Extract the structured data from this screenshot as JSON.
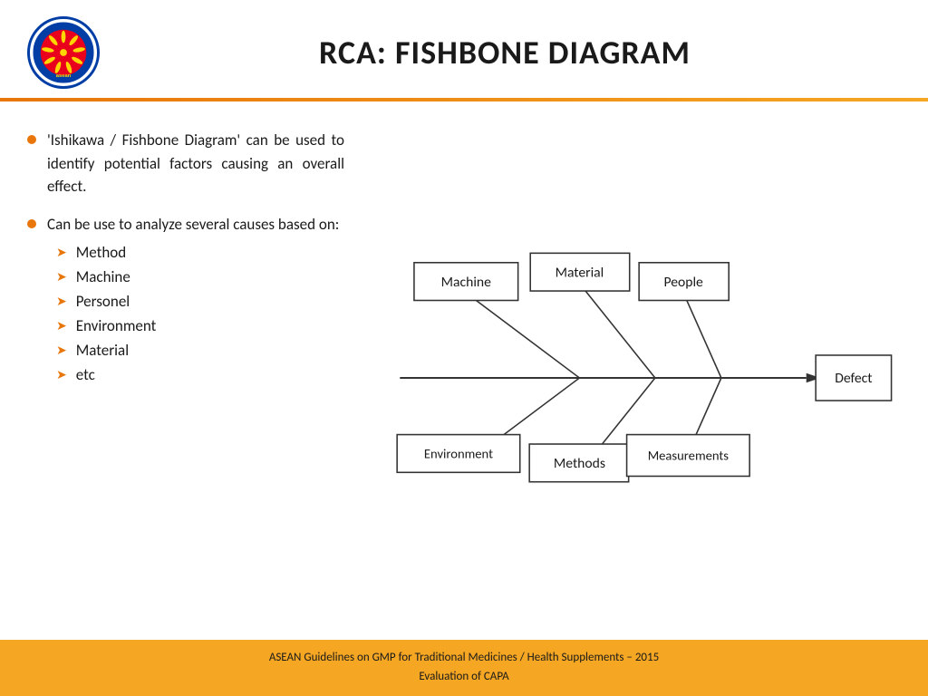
{
  "header": {
    "title": "RCA: FISHBONE DIAGRAM",
    "logo_alt": "ASEAN Logo"
  },
  "bullets": [
    {
      "text": "'Ishikawa / Fishbone Diagram' can be used to identify potential factors causing an overall effect."
    },
    {
      "text": "Can be use to analyze several causes based on:",
      "sub_items": [
        "Method",
        "Machine",
        "Personel",
        "Environment",
        "Material",
        "etc"
      ]
    }
  ],
  "diagram": {
    "boxes": {
      "machine": "Machine",
      "material": "Material",
      "people": "People",
      "environment": "Environment",
      "methods": "Methods",
      "measurements": "Measurements",
      "defect": "Defect"
    }
  },
  "footer": {
    "line1": "ASEAN Guidelines on GMP for Traditional Medicines  / Health Supplements – 2015",
    "line2": "Evaluation of CAPA"
  }
}
